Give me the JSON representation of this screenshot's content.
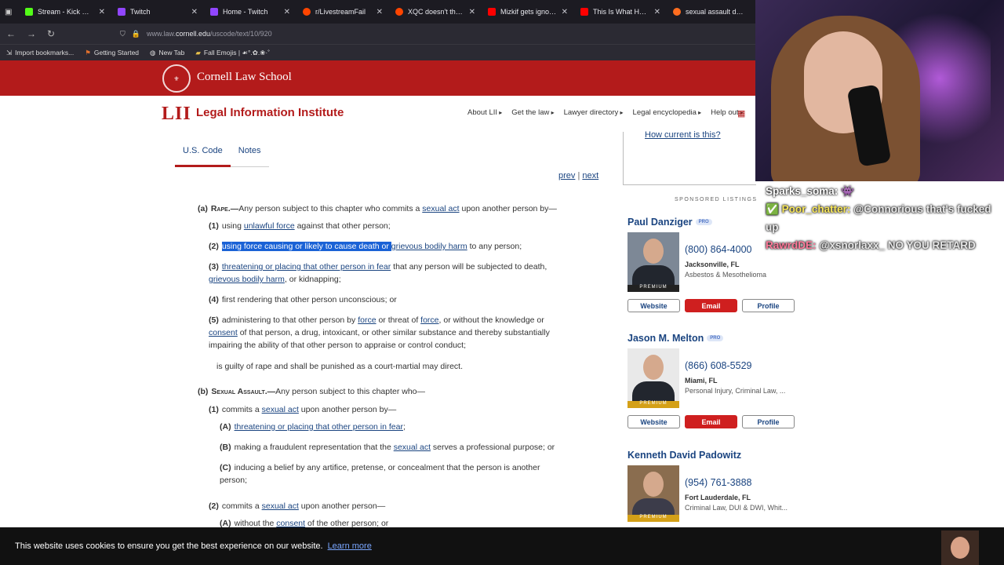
{
  "browser": {
    "tabs": [
      {
        "title": "Stream - Kick Dashboard",
        "color": "#53fc18"
      },
      {
        "title": "Twitch",
        "color": "#9146ff"
      },
      {
        "title": "Home - Twitch",
        "color": "#9146ff"
      },
      {
        "title": "r/LivestreamFail",
        "color": "#ff4500"
      },
      {
        "title": "XQC doesn't think Mizki",
        "color": "#ff4500"
      },
      {
        "title": "Mizkif gets ignored and",
        "color": "#ff0000"
      },
      {
        "title": "This Is What Happ",
        "color": "#ff0000"
      },
      {
        "title": "sexual assault define",
        "color": "#ff6d1f"
      }
    ],
    "url_prefix": "www.law.",
    "url_host": "cornell.edu",
    "url_path": "/uscode/text/10/920",
    "bookmarks": [
      "Import bookmarks...",
      "Getting Started",
      "New Tab",
      "Fall Emojis | ☙°.✿.❀·˚"
    ]
  },
  "header": {
    "school": "Cornell Law School",
    "lii_logo": "LII",
    "lii_name": "Legal Information Institute",
    "nav": [
      "About LII",
      "Get the law",
      "Lawyer directory",
      "Legal encyclopedia",
      "Help out"
    ]
  },
  "doc_tabs": [
    "U.S. Code",
    "Notes"
  ],
  "pager": {
    "prev": "prev",
    "sep": "|",
    "next": "next"
  },
  "law": {
    "a_label": "(a)",
    "a_head": "Rape.—",
    "a_intro": "Any person subject to this chapter who commits a ",
    "sexual_act": "sexual act",
    "a_intro_end": " upon another person by—",
    "a1_label": "(1)",
    "a1_pre": "using ",
    "a1_link": "unlawful force",
    "a1_post": " against that other person;",
    "a2_label": "(2)",
    "a2_hl": "using force causing or likely to cause death or ",
    "a2_link": "grievous bodily harm",
    "a2_post": " to any person;",
    "a3_label": "(3)",
    "a3_link": "threatening or placing that other person in fear",
    "a3_post": " that any person will be subjected to death,",
    "a3_link2": "grievous bodily harm",
    "a3_post2": ", or kidnapping;",
    "a4_label": "(4)",
    "a4_text": "first rendering that other person unconscious; or",
    "a5_label": "(5)",
    "a5_pre": "administering to that other person by ",
    "force": "force",
    "a5_mid": " or threat of ",
    "a5_post": ", or without the knowledge or",
    "consent": "consent",
    "a5_line2": " of that person, a drug, intoxicant, or other similar substance and thereby substantially",
    "a5_line3": "impairing the ability of that other person to appraise or control conduct;",
    "a_close": "is guilty of rape and shall be punished as a court-martial may direct.",
    "b_label": "(b)",
    "b_head": "Sexual Assault.—",
    "b_intro": "Any person subject to this chapter who—",
    "b1_label": "(1)",
    "b1_pre": "commits a ",
    "b1_post": " upon another person by—",
    "bA_label": "(A)",
    "bA_link": "threatening or placing that other person in fear",
    "bA_post": ";",
    "bB_label": "(B)",
    "bB_pre": "making a fraudulent representation that the ",
    "bB_post": " serves a professional purpose; or",
    "bC_label": "(C)",
    "bC_text": "inducing a belief by any artifice, pretense, or concealment that the person is another",
    "bC_text2": "person;",
    "b2_label": "(2)",
    "b2_pre": "commits a ",
    "b2_post": " upon another person—",
    "b2A_label": "(A)",
    "b2A_pre": "without the ",
    "b2A_post": " of the other person; or"
  },
  "sidebar": {
    "how_current": "How current is this?",
    "sponsored": "SPONSORED LISTINGS",
    "lawyers": [
      {
        "name": "Paul Danziger",
        "pro": "PRO",
        "phone": "(800) 864-4000",
        "city": "Jacksonville, FL",
        "practice": "Asbestos & Mesothelioma",
        "badge": "PREMIUM"
      },
      {
        "name": "Jason M. Melton",
        "pro": "PRO",
        "phone": "(866) 608-5529",
        "city": "Miami, FL",
        "practice": "Personal Injury, Criminal Law, ...",
        "badge": "PREMIUM"
      },
      {
        "name": "Kenneth David Padowitz",
        "pro": "",
        "phone": "(954) 761-3888",
        "city": "Fort Lauderdale, FL",
        "practice": "Criminal Law, DUI & DWI, Whit...",
        "badge": "PREMIUM"
      }
    ],
    "buttons": {
      "website": "Website",
      "email": "Email",
      "profile": "Profile"
    }
  },
  "chat": [
    {
      "user": "Sparks_soma:",
      "msg": "👾"
    },
    {
      "user": "Poor_chatter:",
      "msg": "@Connorious that's fucked up"
    },
    {
      "user": "RawrdDE:",
      "msg": "@xsnorlaxx_ NO YOU RETARD"
    }
  ],
  "cookie": {
    "text": "This website uses cookies to ensure you get the best experience on our website.",
    "learn": "Learn more"
  }
}
